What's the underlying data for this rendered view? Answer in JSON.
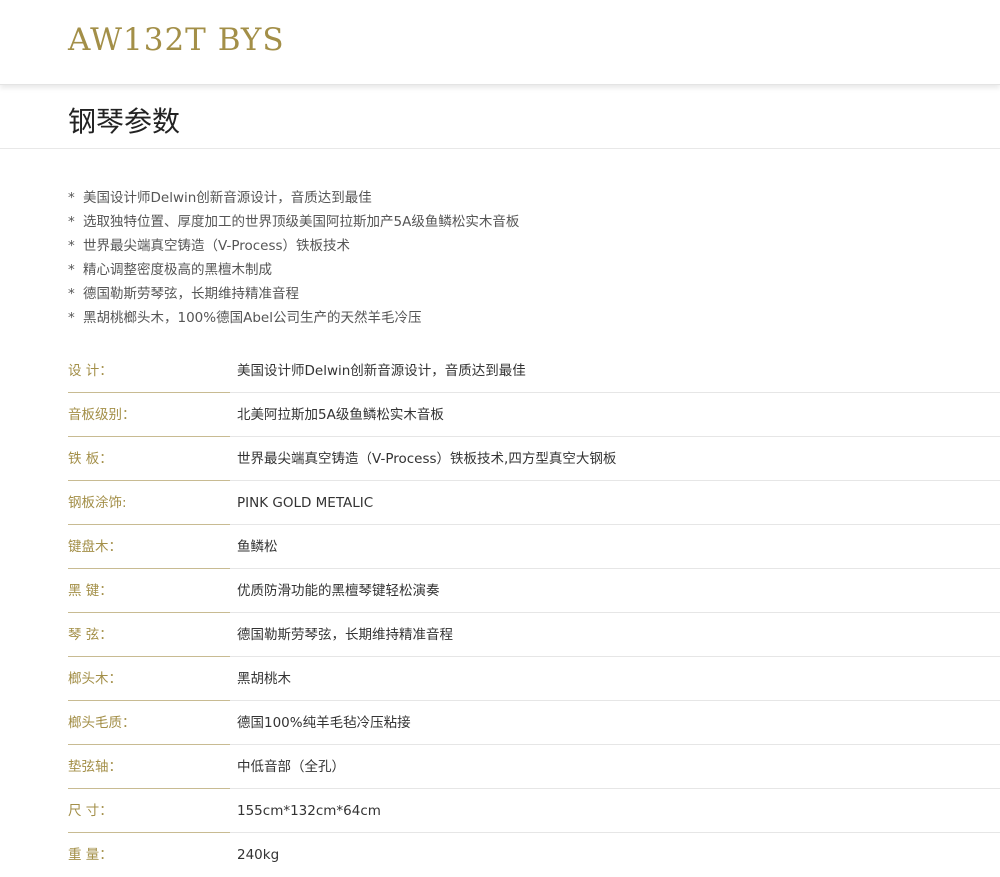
{
  "header": {
    "model": "AW132T BYS"
  },
  "section": {
    "title": "钢琴参数"
  },
  "features": [
    "美国设计师Delwin创新音源设计，音质达到最佳",
    "选取独特位置、厚度加工的世界顶级美国阿拉斯加产5A级鱼鳞松实木音板",
    "世界最尖端真空铸造（V-Process）铁板技术",
    "精心调整密度极高的黑檀木制成",
    "德国勒斯劳琴弦，长期维持精准音程",
    "黑胡桃榔头木，100%德国Abel公司生产的天然羊毛冷压"
  ],
  "feature_marker": "*",
  "specs": [
    {
      "label": "设 计：",
      "value": "美国设计师Delwin创新音源设计，音质达到最佳"
    },
    {
      "label": "音板级别：",
      "value": "北美阿拉斯加5A级鱼鳞松实木音板"
    },
    {
      "label": "铁 板：",
      "value": "世界最尖端真空铸造（V-Process）铁板技术,四方型真空大钢板"
    },
    {
      "label": "钢板涂饰:",
      "value": "PINK GOLD METALIC"
    },
    {
      "label": "键盘木：",
      "value": "鱼鳞松"
    },
    {
      "label": "黑 键：",
      "value": "优质防滑功能的黑檀琴键轻松演奏"
    },
    {
      "label": "琴 弦：",
      "value": "德国勒斯劳琴弦，长期维持精准音程"
    },
    {
      "label": "榔头木：",
      "value": "黑胡桃木"
    },
    {
      "label": "榔头毛质：",
      "value": "德国100%纯羊毛毡冷压粘接"
    },
    {
      "label": "垫弦轴：",
      "value": "中低音部（全孔）"
    },
    {
      "label": "尺 寸：",
      "value": "155cm*132cm*64cm"
    },
    {
      "label": "重 量：",
      "value": "240kg"
    }
  ],
  "colors": {
    "accent_gold": "#a38f48",
    "text": "#333333"
  }
}
